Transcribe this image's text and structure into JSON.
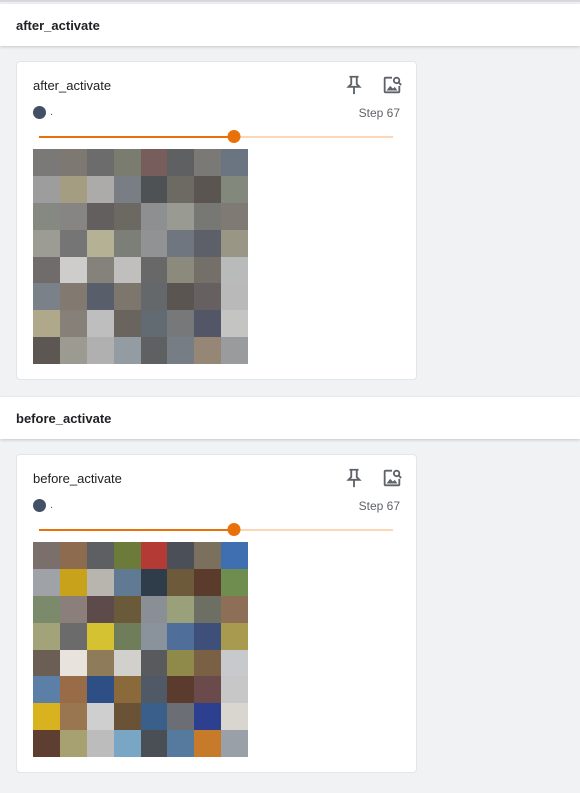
{
  "sections": [
    {
      "header": "after_activate",
      "card": {
        "title": "after_activate",
        "run_label": ".",
        "step_label": "Step 67",
        "slider_fraction": 0.55
      }
    },
    {
      "header": "before_activate",
      "card": {
        "title": "before_activate",
        "run_label": ".",
        "step_label": "Step 67",
        "slider_fraction": 0.55
      }
    }
  ],
  "icons": {
    "pin": "pin-icon",
    "image_search": "image-search-icon"
  },
  "colors": {
    "accent": "#e8710a",
    "accent_light": "#fbd7b7",
    "run_color": "#425066",
    "background": "#f1f2f4"
  },
  "image_tile_colors": [
    "#7a6f6a",
    "#8c6b4f",
    "#5d5f63",
    "#6c7a3a",
    "#b33a35",
    "#4b4f57",
    "#7b6f5d",
    "#3f6fb0",
    "#9fa2a6",
    "#c9a21b",
    "#b8b4ae",
    "#5f7a92",
    "#2f3d4a",
    "#6d5a3a",
    "#5b3b2b",
    "#6f8d4e",
    "#7a8a6b",
    "#8a7f7a",
    "#5d4a4a",
    "#6a5a3a",
    "#8a8f95",
    "#9aa17a",
    "#6d6f62",
    "#8d6e57",
    "#a3a37a",
    "#6b6b6b",
    "#d4c233",
    "#6f7d5a",
    "#8a939b",
    "#4f6f9a",
    "#3e4f7a",
    "#a89a4e",
    "#6b5e55",
    "#e8e3dc",
    "#8e7b5a",
    "#d2d0cc",
    "#595a5e",
    "#8f8a4a",
    "#7a6045",
    "#c7c9cc",
    "#5b7fa6",
    "#9a6b47",
    "#2e4e86",
    "#8a6a3a",
    "#4f5a66",
    "#5a3b2e",
    "#6a4a4a",
    "#c7c7c7",
    "#d9b21f",
    "#9a7650",
    "#cfcfcf",
    "#6a5236",
    "#3a5f8a",
    "#6b6f75",
    "#2d3f8f",
    "#d9d6cf",
    "#5d3e30",
    "#a7a070",
    "#bcbcbc",
    "#78a6c4",
    "#4a4f55",
    "#567a9e",
    "#c77a2a",
    "#9aa0a8"
  ]
}
